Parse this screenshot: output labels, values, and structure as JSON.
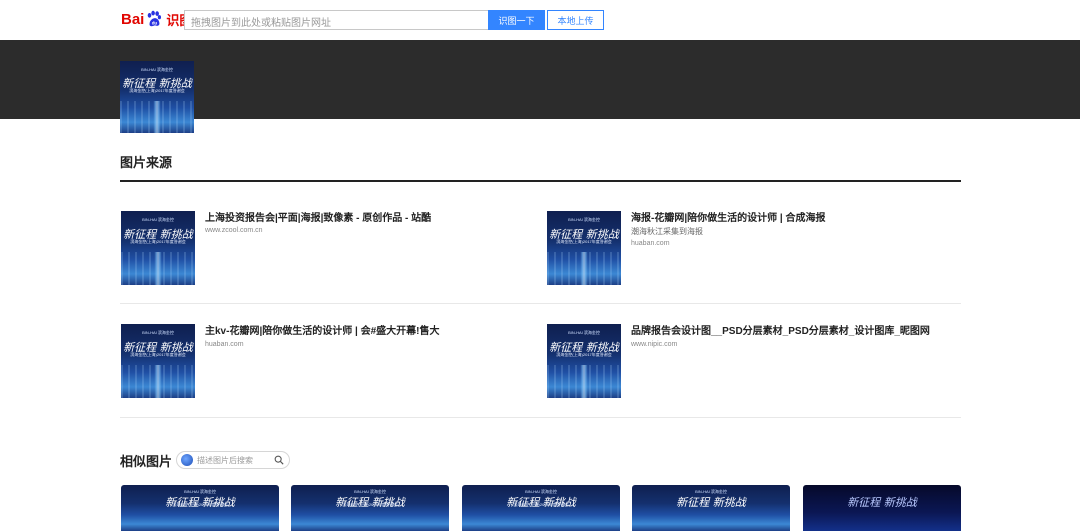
{
  "header": {
    "logo": {
      "bai": "Bai",
      "du": "du",
      "shitu": "识图"
    },
    "search_placeholder": "拖拽图片到此处或粘贴图片网址",
    "search_button": "识图一下",
    "upload_button": "本地上传"
  },
  "query_image": {
    "brand": "BIN-HAI 滨海金控",
    "headline": "新征程 新挑战",
    "subline": "滨海金控(上海)2017年度答谢会"
  },
  "sources": {
    "title": "图片来源",
    "items": [
      {
        "title": "上海投资报告会|平面|海报|致像素 - 原创作品 - 站酷",
        "desc": "",
        "url": "www.zcool.com.cn"
      },
      {
        "title": "海报-花瓣网|陪你做生活的设计师 | 合成海报",
        "desc": "潮海秋江采集到海报",
        "url": "huaban.com"
      },
      {
        "title": "主kv-花瓣网|陪你做生活的设计师 | 会#盛大开幕!售大",
        "desc": "",
        "url": "huaban.com"
      },
      {
        "title": "品牌报告会设计图__PSD分层素材_PSD分层素材_设计图库_昵图网",
        "desc": "",
        "url": "www.nipic.com"
      }
    ]
  },
  "similar": {
    "title": "相似图片",
    "search_placeholder": "描述图片后搜索",
    "count": 5
  },
  "colors": {
    "accent": "#3385ff",
    "banner": "#2c2c2c",
    "logo_red": "#e10601"
  }
}
